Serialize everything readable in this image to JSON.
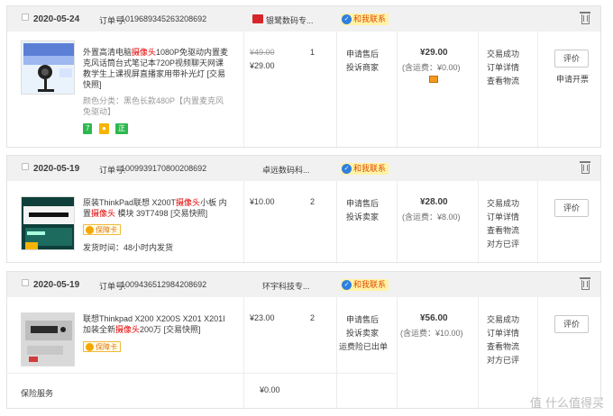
{
  "orders": [
    {
      "date": "2020-05-24",
      "order_no_label": "订单号:",
      "order_no": "1019689345263208692",
      "shop": "银鹭数码专...",
      "contact": "和我联系",
      "product": {
        "title_pre": "外置高清电脑",
        "title_hl": "摄像头",
        "title_post": "1080P免驱动内置麦克风话筒台式笔记本720P视频聊天网课教学生上课视屏直播家用带补光灯 [交易快照]",
        "sku": "颜色分类：黑色长款480P【内置麦克风免驱动】",
        "badges": [
          "7",
          "⬤",
          "正"
        ],
        "original_price": "¥49.00",
        "price": "¥29.00",
        "qty": "1"
      },
      "service": [
        "申请售后",
        "投诉商家"
      ],
      "total": "¥29.00",
      "shipping": "(含运费：¥0.00)",
      "status": [
        "交易成功",
        "订单详情",
        "查看物流"
      ],
      "action_button": "评价",
      "extra_action": "申请开票"
    },
    {
      "date": "2020-05-19",
      "order_no_label": "订单号:",
      "order_no": "1009939170800208692",
      "shop": "卓远数码科...",
      "contact": "和我联系",
      "product": {
        "title_pre": "原装ThinkPad联想 X200T",
        "title_hl": "摄像头",
        "title_post": "小板 内置",
        "title_hl2": "摄像头",
        "title_post2": " 模块 39T7498 [交易快照]",
        "bao": "保障卡",
        "ship_time": "发货时间：48小时内发货",
        "price": "¥10.00",
        "qty": "2"
      },
      "service": [
        "申请售后",
        "投诉卖家"
      ],
      "total": "¥28.00",
      "shipping": "(含运费：¥8.00)",
      "status": [
        "交易成功",
        "订单详情",
        "查看物流",
        "对方已评"
      ],
      "action_button": "评价"
    },
    {
      "date": "2020-05-19",
      "order_no_label": "订单号:",
      "order_no": "1009436512984208692",
      "shop": "环宇科技专...",
      "contact": "和我联系",
      "product": {
        "title_pre": "联想Thinkpad X200 X200S X201 X201I加装全新",
        "title_hl": "摄像头",
        "title_post": "200万 [交易快照]",
        "bao": "保障卡",
        "price": "¥23.00",
        "qty": "2"
      },
      "service": [
        "申请售后",
        "投诉卖家",
        "运费险已出单"
      ],
      "total": "¥56.00",
      "shipping": "(含运费：¥10.00)",
      "status": [
        "交易成功",
        "订单详情",
        "查看物流",
        "对方已评"
      ],
      "action_button": "评价",
      "insurance_label": "保险服务",
      "insurance_price": "¥0.00"
    }
  ],
  "watermark": "值 什么值得买",
  "colors": {
    "highlight": "#e10000",
    "contact_bg": "#fff3a6",
    "header_bg": "#f1f1f1"
  }
}
